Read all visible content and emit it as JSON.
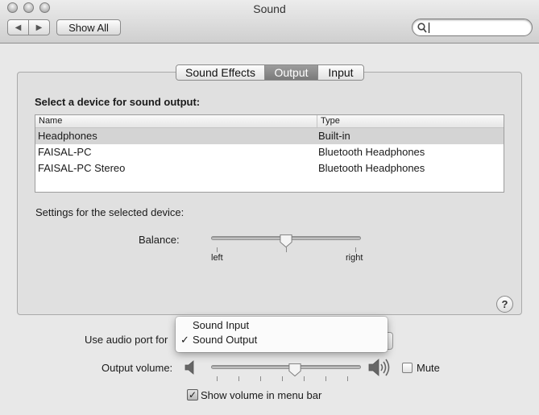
{
  "window": {
    "title": "Sound"
  },
  "toolbar": {
    "back_icon": "chevron-left-icon",
    "forward_icon": "chevron-right-icon",
    "show_all_label": "Show All",
    "search_value": "",
    "search_icon": "magnifier-icon"
  },
  "tabs": [
    {
      "label": "Sound Effects",
      "active": false
    },
    {
      "label": "Output",
      "active": true
    },
    {
      "label": "Input",
      "active": false
    }
  ],
  "output": {
    "heading": "Select a device for sound output:",
    "columns": [
      "Name",
      "Type"
    ],
    "devices": [
      {
        "name": "Headphones",
        "type": "Built-in",
        "selected": true
      },
      {
        "name": "FAISAL-PC",
        "type": "Bluetooth Headphones",
        "selected": false
      },
      {
        "name": "FAISAL-PC Stereo",
        "type": "Bluetooth Headphones",
        "selected": false
      }
    ],
    "settings_heading": "Settings for the selected device:",
    "balance": {
      "label": "Balance:",
      "left_label": "left",
      "right_label": "right",
      "value": 0.5
    },
    "help_label": "?"
  },
  "audio_port": {
    "label": "Use audio port for",
    "menu_items": [
      {
        "label": "Sound Input",
        "checked": false
      },
      {
        "label": "Sound Output",
        "checked": true
      }
    ],
    "check_mark": "✓"
  },
  "volume": {
    "label": "Output volume:",
    "value": 0.56,
    "mute_label": "Mute",
    "mute_checked": false,
    "low_icon": "speaker-low-icon",
    "high_icon": "speaker-high-icon"
  },
  "menu_bar": {
    "label": "Show volume in menu bar",
    "checked": true,
    "check_mark": "✓"
  },
  "colors": {
    "selection_row": "#d4d4d4",
    "active_tab": "#8a8a8a"
  }
}
